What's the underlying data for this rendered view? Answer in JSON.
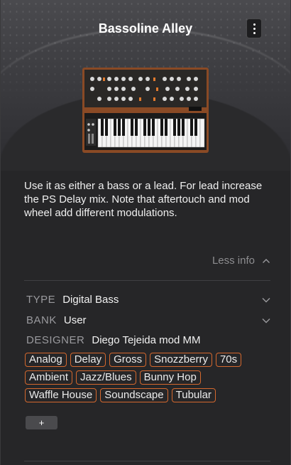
{
  "preset": {
    "title": "Bassoline Alley",
    "description": "Use it as either a bass or a lead. For lead increase the PS Delay mix. Note that aftertouch and mod wheel add different modulations.",
    "less_info_label": "Less info"
  },
  "attributes": {
    "type_key": "TYPE",
    "type_value": "Digital Bass",
    "bank_key": "BANK",
    "bank_value": "User",
    "designer_key": "DESIGNER",
    "designer_value": "Diego Tejeida mod MM"
  },
  "tags": [
    "Analog",
    "Delay",
    "Gross",
    "Snozzberry",
    "70s",
    "Ambient",
    "Jazz/Blues",
    "Bunny Hop",
    "Waffle House",
    "Soundscape",
    "Tubular"
  ],
  "add_tag_label": "+",
  "colors": {
    "tag_border": "#d4682e",
    "background": "#262628",
    "muted_text": "#8d8d90"
  },
  "icons": {
    "menu": "kebab-menu-icon",
    "collapse": "chevron-up-icon",
    "dropdown": "chevron-down-icon"
  }
}
